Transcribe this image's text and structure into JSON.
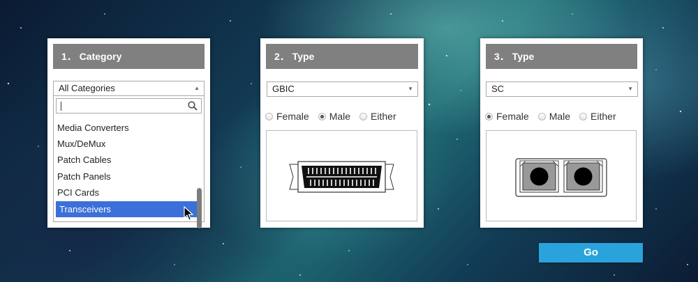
{
  "category_card": {
    "header": "1． Category",
    "selected_value": "All Categories",
    "search": {
      "value": ""
    },
    "options": [
      {
        "label": "Media Converters"
      },
      {
        "label": "Mux/DeMux"
      },
      {
        "label": "Patch Cables"
      },
      {
        "label": "Patch Panels"
      },
      {
        "label": "PCI Cards"
      },
      {
        "label": "Transceivers",
        "highlighted": true
      }
    ]
  },
  "type_card_1": {
    "header": "2． Type",
    "selected_value": "GBIC",
    "radio_options": [
      {
        "label": "Female",
        "checked": false
      },
      {
        "label": "Male",
        "checked": true
      },
      {
        "label": "Either",
        "checked": false
      }
    ],
    "image": "gbic-connector"
  },
  "type_card_2": {
    "header": "3． Type",
    "selected_value": "SC",
    "radio_options": [
      {
        "label": "Female",
        "checked": true
      },
      {
        "label": "Male",
        "checked": false
      },
      {
        "label": "Either",
        "checked": false
      }
    ],
    "image": "sc-duplex-connector"
  },
  "go_button": {
    "label": "Go"
  },
  "colors": {
    "header_bg": "#808080",
    "highlight": "#3b6fd9",
    "go_button": "#2aa3dc"
  }
}
